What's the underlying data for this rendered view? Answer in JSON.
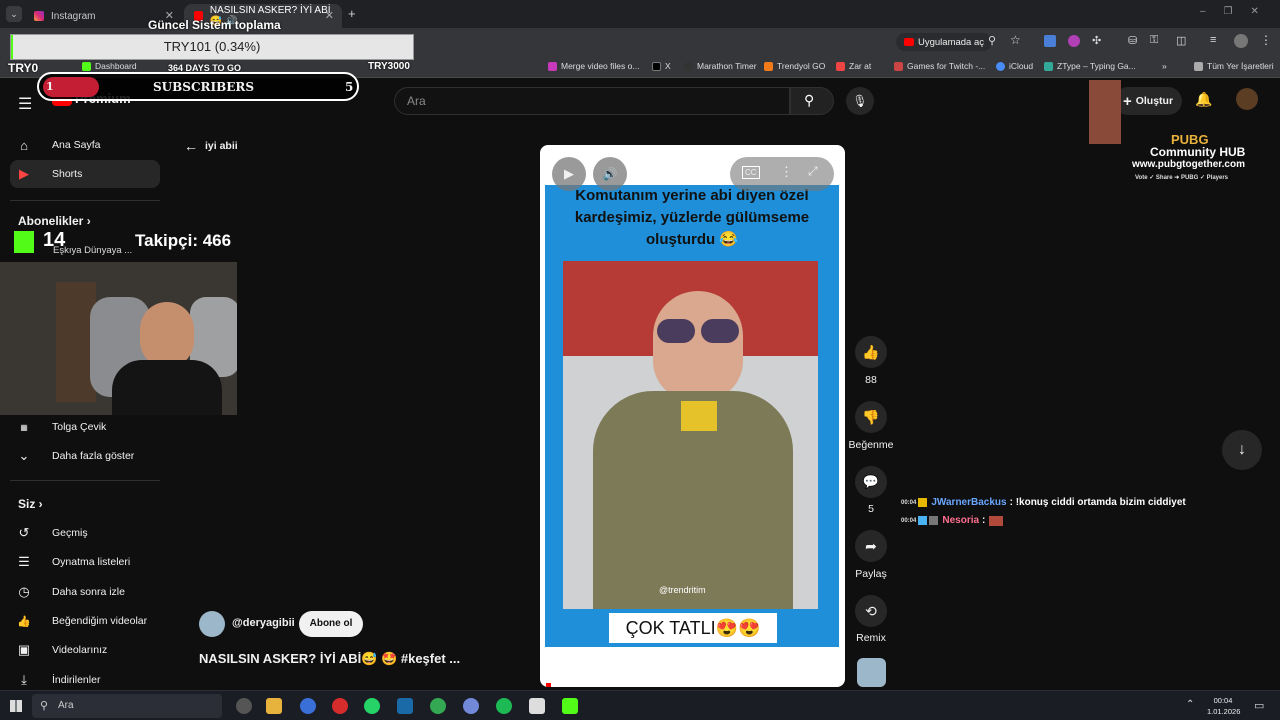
{
  "browser": {
    "tabs": [
      {
        "label": "Instagram",
        "active": false
      },
      {
        "label": "NASILSIN ASKER? İYİ ABİ😅 🔊",
        "active": true
      }
    ],
    "new_tab": "+",
    "open_in_app": "Uygulamada aç",
    "bookmarks": [
      "Dashboard",
      "Merge video files o...",
      "X",
      "Marathon Timer",
      "Trendyol GO",
      "Zar at",
      "Games for Twitch -...",
      "iCloud",
      "ZType – Typing Ga...",
      "Tüm Yer İşaretleri"
    ]
  },
  "stream_overlay": {
    "goal_title": "Güncel Sistem toplama",
    "goal_value": "TRY101 (0.34%)",
    "ticker_left": "TRY0",
    "ticker_mid": "364 DAYS TO GO",
    "ticker_right": "TRY3000",
    "subs_left": "1",
    "subs_label": "SUBSCRIBERS",
    "subs_right": "5",
    "kick_count": "14",
    "followers": "Takipçi: 466",
    "pubg_title": "PUBG",
    "pubg_sub": "Community HUB",
    "pubg_url": "www.pubgtogether.com",
    "pubg_tag": "Vote ✓ Share ➜ PUBG ✓ Players",
    "chat": [
      {
        "time": "00:04",
        "user": "JWarnerBackus",
        "text": ": !konuş ciddi ortamda bizim ciddiyet",
        "color": "#6aa6ff"
      },
      {
        "time": "00:04",
        "user": "Nesoria",
        "text": ":",
        "color": "#ff6f91"
      }
    ]
  },
  "youtube": {
    "logo": "Premium",
    "search_placeholder": "Ara",
    "create": "Oluştur",
    "back_label": "iyi abii",
    "sidebar": {
      "main": [
        {
          "label": "Ana Sayfa",
          "icon": "⌂"
        },
        {
          "label": "Shorts",
          "icon": "▶"
        }
      ],
      "subs_heading": "Abonelikler",
      "subs": [
        {
          "label": "Eşkıya Dünyaya ..."
        },
        {
          "label": "Tolga Çevik"
        },
        {
          "label": "Daha fazla göster"
        }
      ],
      "you_heading": "Siz",
      "you": [
        {
          "label": "Geçmiş",
          "icon": "↺"
        },
        {
          "label": "Oynatma listeleri",
          "icon": "☰"
        },
        {
          "label": "Daha sonra izle",
          "icon": "◷"
        },
        {
          "label": "Beğendiğim videolar",
          "icon": "👍"
        },
        {
          "label": "Videolarınız",
          "icon": "▣"
        },
        {
          "label": "İndirilenler",
          "icon": "⤓"
        }
      ]
    },
    "short": {
      "caption_top": "Komutanım yerine abi diyen özel kardeşimiz, yüzlerde gülümseme oluşturdu 😂",
      "watermark": "@trendritim",
      "caption_bottom": "ÇOK TATLI😍😍",
      "channel": "@deryagibii",
      "subscribe": "Abone ol",
      "title": "NASILSIN ASKER? İYİ ABİ😅 🤩 #keşfet ..."
    },
    "actions": {
      "likes": "88",
      "dislike": "Beğenme",
      "comments": "5",
      "share": "Paylaş",
      "remix": "Remix"
    }
  },
  "taskbar": {
    "search": "Ara",
    "time": "00:04",
    "date": "1.01.2026"
  }
}
